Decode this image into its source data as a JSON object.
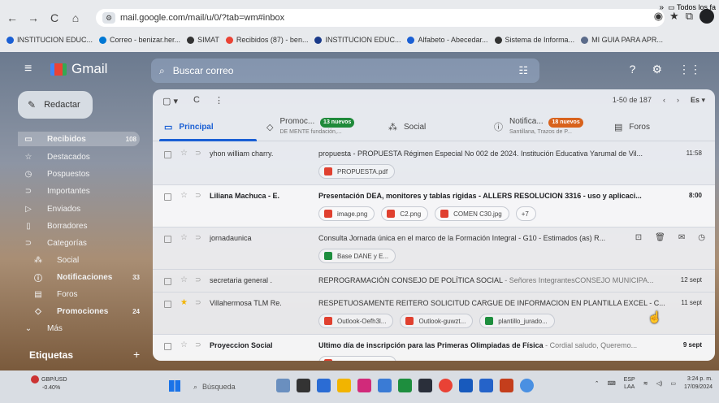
{
  "browser": {
    "url": "mail.google.com/mail/u/0/?tab=wm#inbox",
    "bookmarks": [
      {
        "label": "INSTITUCION EDUC...",
        "color": "#1a5fd4"
      },
      {
        "label": "Correo - benizar.her...",
        "color": "#0078d4"
      },
      {
        "label": "SIMAT",
        "color": "#333333"
      },
      {
        "label": "Recibidos (87) - ben...",
        "color": "#ea4335"
      },
      {
        "label": "INSTITUCION EDUC...",
        "color": "#1a3a8a"
      },
      {
        "label": "Alfabeto - Abecedar...",
        "color": "#1a5fd4"
      },
      {
        "label": "Sistema de Informa...",
        "color": "#333333"
      },
      {
        "label": "MI GUIA PARA APR...",
        "color": "#5b6b8a"
      }
    ],
    "more_label": "»",
    "all_bookmarks": "Todos los fa"
  },
  "gmail": {
    "app_name": "Gmail",
    "search_placeholder": "Buscar correo",
    "compose_label": "Redactar",
    "sidebar": [
      {
        "label": "Recibidos",
        "count": "108",
        "icon": "inbox-icon",
        "glyph": "▭"
      },
      {
        "label": "Destacados",
        "count": "",
        "icon": "star-icon",
        "glyph": "☆"
      },
      {
        "label": "Pospuestos",
        "count": "",
        "icon": "clock-icon",
        "glyph": "◷"
      },
      {
        "label": "Importantes",
        "count": "",
        "icon": "important-icon",
        "glyph": "⊃"
      },
      {
        "label": "Enviados",
        "count": "",
        "icon": "send-icon",
        "glyph": "▷"
      },
      {
        "label": "Borradores",
        "count": "",
        "icon": "draft-icon",
        "glyph": "▯"
      },
      {
        "label": "Categorías",
        "count": "",
        "icon": "label-icon",
        "glyph": "⊃"
      },
      {
        "label": "Social",
        "count": "",
        "icon": "people-icon",
        "glyph": "⁂"
      },
      {
        "label": "Notificaciones",
        "count": "33",
        "icon": "info-icon",
        "glyph": "ⓘ"
      },
      {
        "label": "Foros",
        "count": "",
        "icon": "forum-icon",
        "glyph": "▤"
      },
      {
        "label": "Promociones",
        "count": "24",
        "icon": "tag-icon",
        "glyph": "◇"
      },
      {
        "label": "Más",
        "count": "",
        "icon": "chevron-down-icon",
        "glyph": "⌄"
      }
    ],
    "labels_heading": "Etiquetas",
    "pager": "1-50 de 187",
    "language": "Es",
    "tabs": {
      "primary": "Principal",
      "promo": "Promoc...",
      "promo_badge": "13 nuevos",
      "promo_sub": "DE MENTE fundación,...",
      "social": "Social",
      "notif": "Notifica...",
      "notif_badge": "18 nuevos",
      "notif_sub": "Santillana, Trazos de P...",
      "forums": "Foros"
    },
    "emails": [
      {
        "sender": "yhon william charry.",
        "subject": "propuesta - PROPUESTA Régimen Especial No 002 de 2024. Institución Educativa Yarumal de Vil...",
        "snippet": "",
        "date": "11:58",
        "unread": false,
        "attachments": [
          {
            "name": "PROPUESTA.pdf",
            "type": "pdf"
          }
        ]
      },
      {
        "sender": "Liliana Machuca - E.",
        "subject": "Presentación DEA, monitores y tablas rigidas - ALLERS RESOLUCION 3316 - uso y aplicaci...",
        "snippet": "",
        "date": "8:00",
        "unread": true,
        "attachments": [
          {
            "name": "image.png",
            "type": "img"
          },
          {
            "name": "C2.png",
            "type": "img"
          },
          {
            "name": "COMEN C30.jpg",
            "type": "img"
          },
          {
            "name": "+7",
            "type": "more"
          }
        ]
      },
      {
        "sender": "jornadaunica",
        "subject": "Consulta Jornada única en el marco de la Formación Integral - G10 - Estimados (as) R...",
        "snippet": "",
        "date": "",
        "unread": false,
        "hover": true,
        "attachments": [
          {
            "name": "Base DANE y E...",
            "type": "xls"
          }
        ]
      },
      {
        "sender": "secretaria general .",
        "subject": "REPROGRAMACIÓN CONSEJO DE POLÍTICA SOCIAL",
        "snippet": " - Señores IntegrantesCONSEJO MUNICIPA...",
        "date": "12 sept",
        "unread": false,
        "attachments": []
      },
      {
        "sender": "Villahermosa TLM Re.",
        "subject": "RESPETUOSAMENTE REITERO SOLICITUD CARGUE DE INFORMACION EN PLANTILLA EXCEL - C...",
        "snippet": "",
        "date": "11 sept",
        "unread": false,
        "star": true,
        "attachments": [
          {
            "name": "Outlook-Oefh3l...",
            "type": "img"
          },
          {
            "name": "Outlook-guwzt...",
            "type": "img"
          },
          {
            "name": "plantillo_jurado...",
            "type": "xls"
          }
        ]
      },
      {
        "sender": "Proyeccion Social",
        "subject": "Ultimo día de inscripción para las Primeras Olimpiadas de Física",
        "snippet": " - Cordial saludo, Queremo...",
        "date": "9 sept",
        "unread": true,
        "attachments": [
          {
            "name": "Organizan.Facu...",
            "type": "img"
          }
        ]
      }
    ]
  },
  "taskbar": {
    "weather_title": "GBP/USD",
    "weather_sub": "-0.40%",
    "search_placeholder": "Búsqueda",
    "lang": "ESP",
    "lang_sub": "LAA",
    "time": "3:24 p. m.",
    "date": "17/09/2024"
  }
}
